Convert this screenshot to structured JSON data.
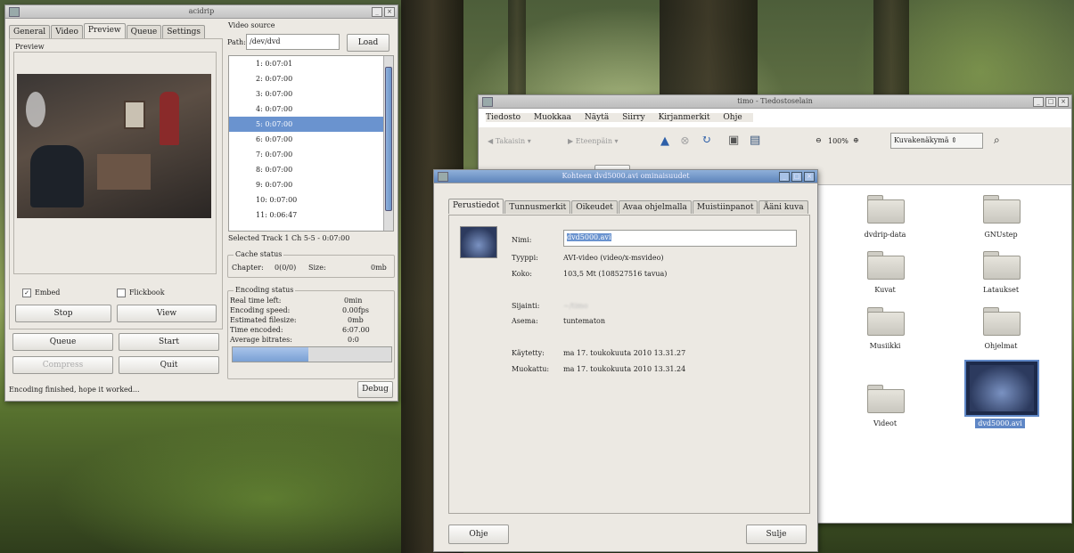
{
  "acidrip": {
    "title": "acidrip",
    "tabs": [
      "General",
      "Video",
      "Preview",
      "Queue",
      "Settings"
    ],
    "preview_label": "Preview",
    "embed_label": "Embed",
    "flickbook_label": "Flickbook",
    "stop_label": "Stop",
    "view_label": "View",
    "queue_label": "Queue",
    "start_label": "Start",
    "compress_label": "Compress",
    "quit_label": "Quit",
    "status_text": "Encoding finished, hope it worked...",
    "debug_label": "Debug",
    "video_source_label": "Video source",
    "path_label": "Path:",
    "path_value": "/dev/dvd",
    "load_label": "Load",
    "tracks": [
      "1: 0:07:01",
      "2: 0:07:00",
      "3: 0:07:00",
      "4: 0:07:00",
      "5: 0:07:00",
      "6: 0:07:00",
      "7: 0:07:00",
      "8: 0:07:00",
      "9: 0:07:00",
      "10: 0:07:00",
      "11: 0:06:47"
    ],
    "selected_track_text": "Selected Track 1 Ch 5-5 - 0:07:00",
    "cache_status_label": "Cache status",
    "chapter_label": "Chapter:",
    "chapter_value": "0(0/0)",
    "size_label": "Size:",
    "size_value": "0mb",
    "encoding_status_label": "Encoding status",
    "enc_rows": [
      {
        "label": "Real time left:",
        "value": "0min"
      },
      {
        "label": "Encoding speed:",
        "value": "0.00fps"
      },
      {
        "label": "Estimated filesize:",
        "value": "0mb"
      },
      {
        "label": "Time encoded:",
        "value": "6:07.00"
      },
      {
        "label": "Average bitrates:",
        "value": "0:0"
      }
    ],
    "encode_progress": 0.48
  },
  "filemanager": {
    "title": "timo - Tiedostoselain",
    "menu": [
      "Tiedosto",
      "Muokkaa",
      "Näytä",
      "Siirry",
      "Kirjanmerkit",
      "Ohje"
    ],
    "back_label": "Takaisin",
    "forward_label": "Eteenpäin",
    "zoom": "100%",
    "view_mode": "Kuvakenäkymä",
    "items": [
      "dvdrip-data",
      "GNUstep",
      "Kuvat",
      "Lataukset",
      "Musiikki",
      "Ohjelmat",
      "Videot",
      "dvd5000.avi"
    ]
  },
  "properties": {
    "title": "Kohteen dvd5000.avi ominaisuudet",
    "tabs": [
      "Perustiedot",
      "Tunnusmerkit",
      "Oikeudet",
      "Avaa ohjelmalla",
      "Muistiinpanot",
      "Ääni kuva"
    ],
    "name_label": "Nimi:",
    "name_value": "dvd5000.avi",
    "type_label": "Tyyppi:",
    "type_value": "AVI-video (video/x-msvideo)",
    "size_label": "Koko:",
    "size_value": "103,5 Mt (108527516 tavua)",
    "location_label": "Sijainti:",
    "location_value": "~/timo",
    "volume_label": "Asema:",
    "volume_value": "tuntematon",
    "accessed_label": "Käytetty:",
    "accessed_value": "ma 17. toukokuuta 2010 13.31.27",
    "modified_label": "Muokattu:",
    "modified_value": "ma 17. toukokuuta 2010 13.31.24",
    "help_label": "Ohje",
    "close_label": "Sulje"
  }
}
